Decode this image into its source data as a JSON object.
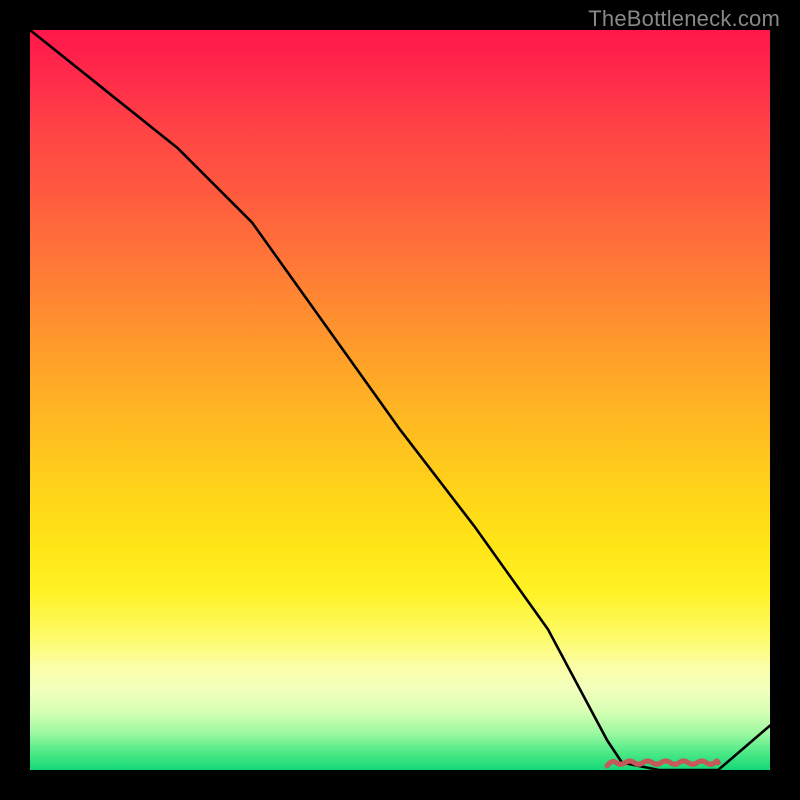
{
  "watermark": "TheBottleneck.com",
  "colors": {
    "background": "#000000",
    "line": "#000000",
    "squiggle": "#c65a5a",
    "watermark": "#888888"
  },
  "chart_data": {
    "type": "line",
    "title": "",
    "xlabel": "",
    "ylabel": "",
    "xlim": [
      0,
      100
    ],
    "ylim": [
      0,
      100
    ],
    "series": [
      {
        "name": "main-curve",
        "x": [
          0,
          10,
          20,
          30,
          40,
          50,
          60,
          70,
          78,
          80,
          85,
          90,
          93,
          100
        ],
        "values": [
          100,
          92,
          84,
          74,
          60,
          46,
          33,
          19,
          4,
          1,
          0,
          0,
          0,
          6
        ]
      }
    ],
    "annotations": [
      {
        "name": "red-squiggle",
        "x_range": [
          78,
          93
        ],
        "y": 1,
        "style": "wavy-underline"
      }
    ],
    "background_gradient": {
      "top": "#ff174a",
      "mid": "#ffe617",
      "bottom": "#15d877"
    },
    "grid": false,
    "legend": false
  }
}
